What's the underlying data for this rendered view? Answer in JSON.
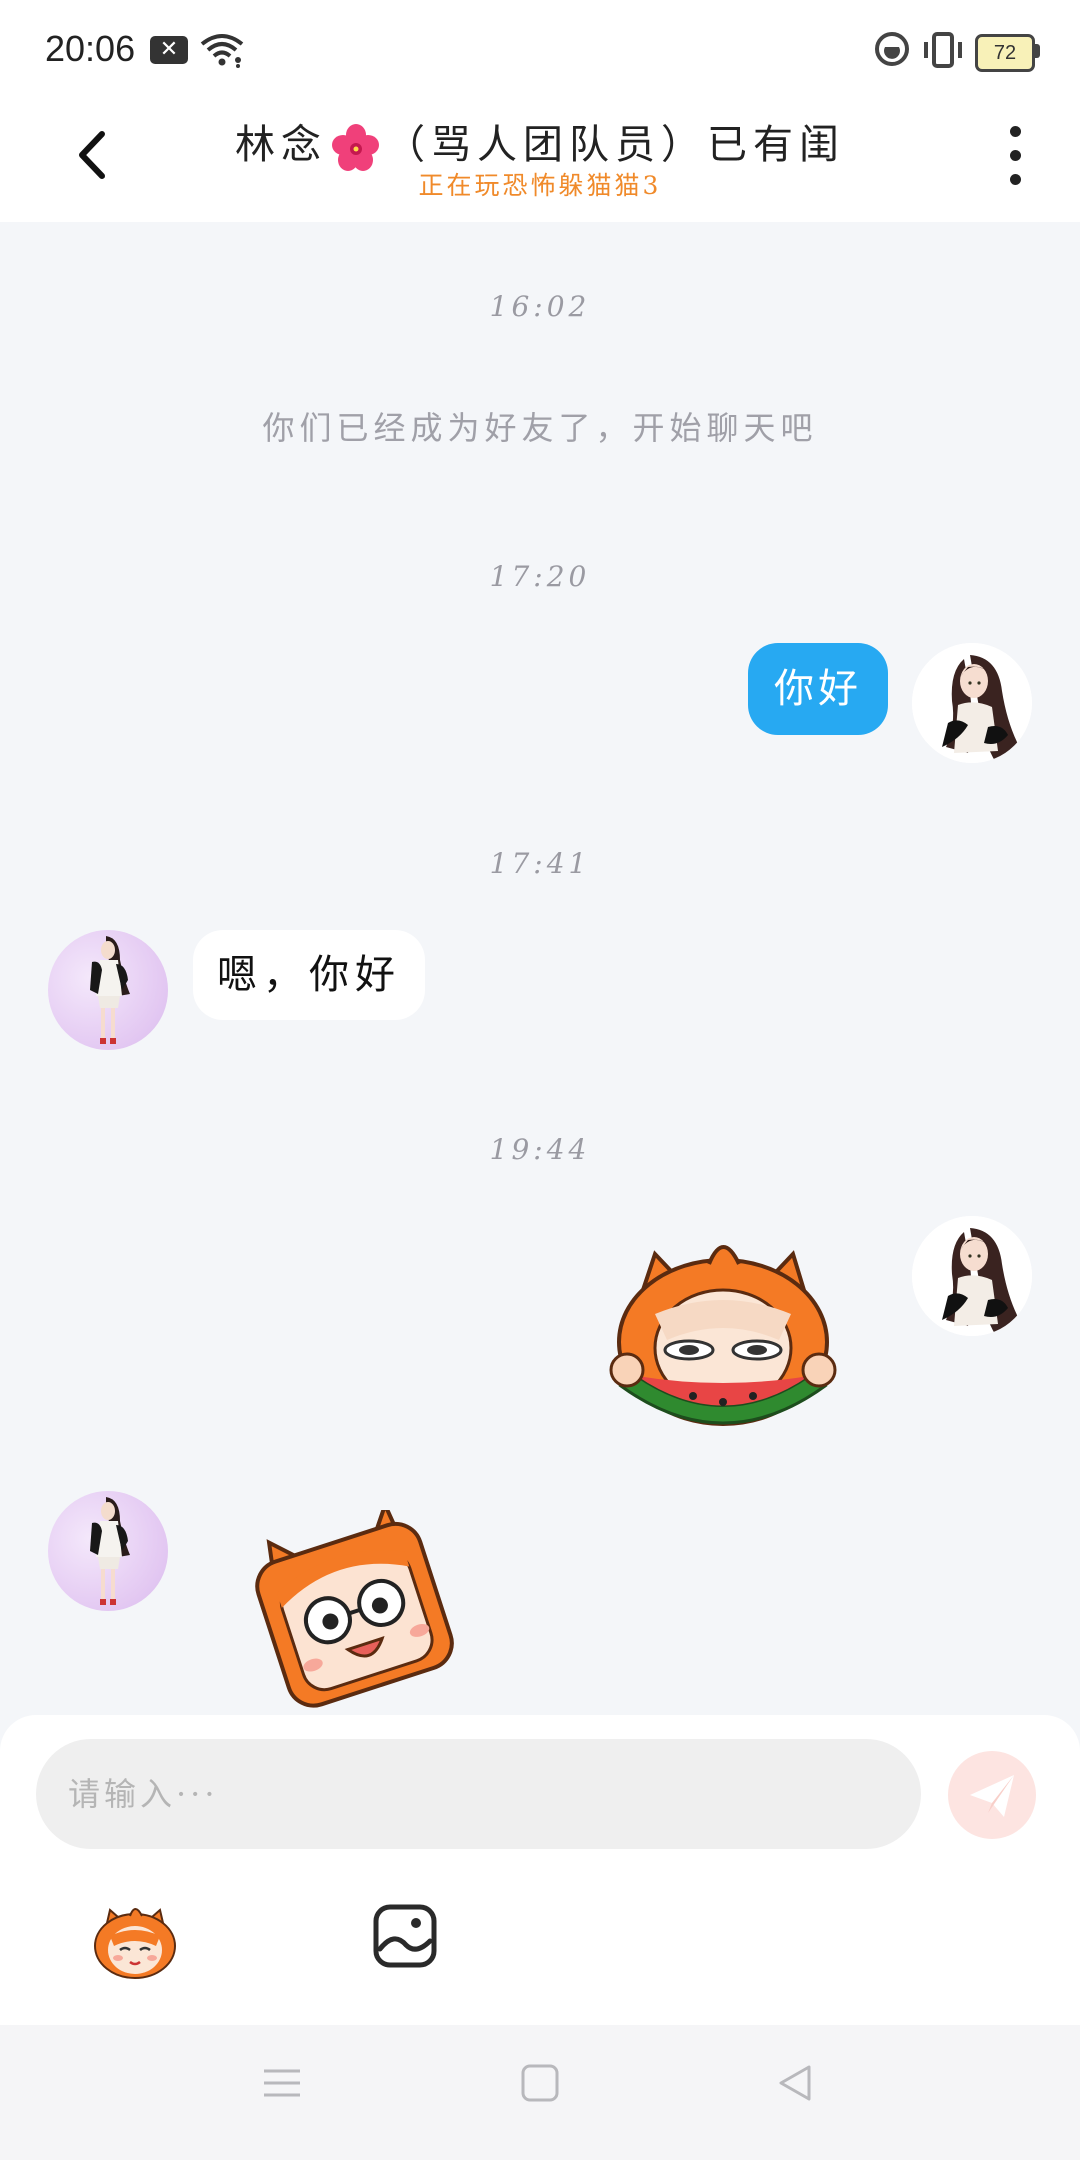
{
  "status_bar": {
    "time": "20:06",
    "battery_level": "72"
  },
  "header": {
    "title_name": "林念",
    "title_suffix": "（骂人团队员）已有闺",
    "subtitle": "正在玩恐怖躲猫猫3"
  },
  "chat": {
    "messages": [
      {
        "type": "timestamp",
        "text": "16:02"
      },
      {
        "type": "system",
        "text": "你们已经成为好友了，开始聊天吧"
      },
      {
        "type": "timestamp",
        "text": "17:20"
      },
      {
        "type": "text",
        "sender": "me",
        "text": "你好"
      },
      {
        "type": "timestamp",
        "text": "17:41"
      },
      {
        "type": "text",
        "sender": "other",
        "text": "嗯，你好"
      },
      {
        "type": "timestamp",
        "text": "19:44"
      },
      {
        "type": "sticker",
        "sender": "me",
        "sticker": "orange-mascot-eating-watermelon"
      },
      {
        "type": "sticker",
        "sender": "other",
        "sticker": "orange-mascot-surprised-tilted"
      }
    ]
  },
  "composer": {
    "placeholder": "请输入···"
  },
  "colors": {
    "accent_blue": "#27a9f2",
    "subtitle_orange": "#f08a2a",
    "send_button_bg": "#fde4e1",
    "chat_bg": "#f4f6f9"
  }
}
